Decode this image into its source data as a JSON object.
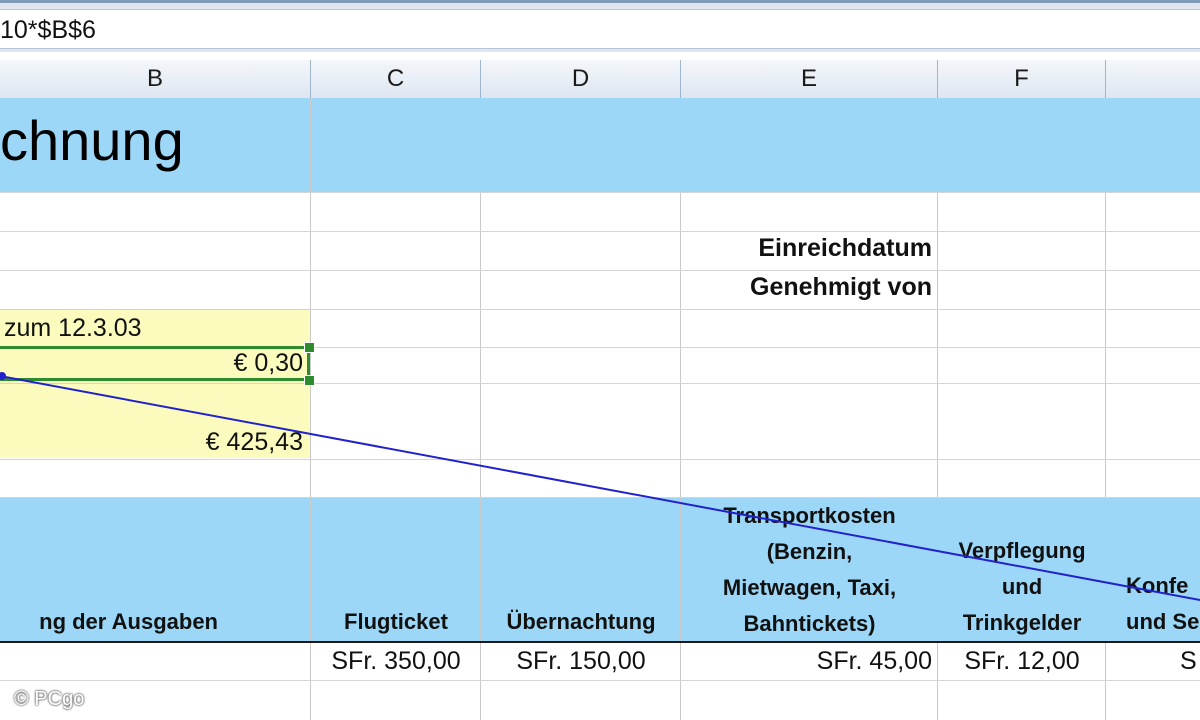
{
  "formula_bar": {
    "text": "10*$B$6"
  },
  "columns": [
    "B",
    "C",
    "D",
    "E",
    "F"
  ],
  "sheet": {
    "title_fragment": "chnung",
    "labels": {
      "einreichdatum": "Einreichdatum",
      "genehmigt": "Genehmigt von"
    },
    "date_fragment": "zum 12.3.03",
    "rate_value": "€ 0,30",
    "total_value": "€ 425,43",
    "headers": {
      "b": "ng der Ausgaben",
      "c": "Flugticket",
      "d": "Übernachtung",
      "e": [
        "Transportkosten",
        "(Benzin,",
        "Mietwagen, Taxi,",
        "Bahntickets)"
      ],
      "f": [
        "Verpflegung",
        "und",
        "Trinkgelder"
      ],
      "g": [
        "Konfe",
        "und Se"
      ]
    },
    "row_values": {
      "c": "SFr. 350,00",
      "d": "SFr. 150,00",
      "e": "SFr. 45,00",
      "f": "SFr. 12,00",
      "g": "S"
    }
  },
  "colors": {
    "band": "#9cd7f7",
    "highlight": "#fbfbbd",
    "selection": "#2e8b2e",
    "trace_arrow": "#2222cc"
  },
  "watermark": "© PCgo"
}
